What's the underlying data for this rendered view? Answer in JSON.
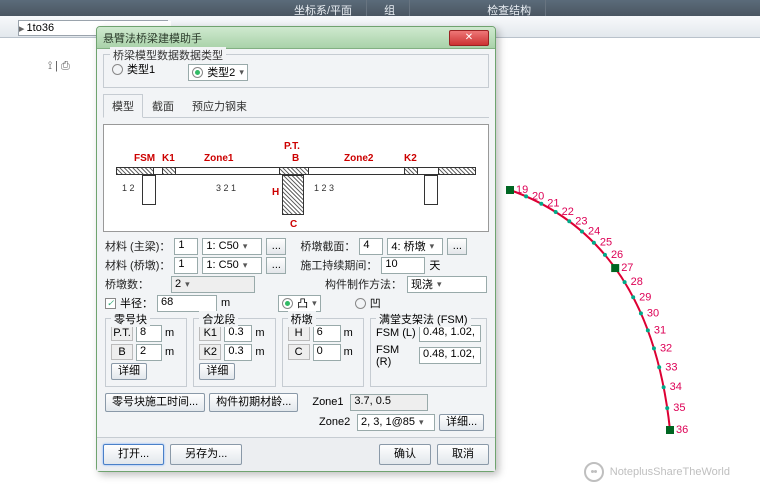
{
  "toolbar": {
    "t1": "坐标系/平面",
    "t2": "组",
    "t3": "检查结构"
  },
  "file_input": "1to36",
  "dialog": {
    "title": "悬臂法桥梁建模助手",
    "data_type_legend": "桥梁模型数据数据类型",
    "type1": "类型1",
    "type2": "类型2",
    "tabs": {
      "model": "模型",
      "section": "截面",
      "prestress": "预应力钢束"
    },
    "diagram": {
      "fsm": "FSM",
      "k1": "K1",
      "zone1": "Zone1",
      "pt": "P.T.",
      "b": "B",
      "zone2": "Zone2",
      "k2": "K2",
      "h": "H",
      "c": "C"
    },
    "mat_main_lbl": "材料 (主梁)：",
    "mat_main_n": "1",
    "mat_main_v": "1: C50",
    "mat_pier_lbl": "材料 (桥墩)：",
    "mat_pier_n": "1",
    "mat_pier_v": "1: C50",
    "pier_sec_lbl": "桥墩截面：",
    "pier_sec_n": "4",
    "pier_sec_v": "4: 桥墩",
    "dur_lbl": "施工持续期间：",
    "dur_v": "10",
    "dur_u": "天",
    "count_lbl": "桥墩数：",
    "count_v": "2",
    "fab_lbl": "构件制作方法：",
    "fab_v": "现浇",
    "radius_chk": "半径：",
    "radius_v": "68",
    "radius_u": "m",
    "convex": "凸",
    "concave": "凹",
    "g0": "零号块",
    "g1": "合龙段",
    "g2": "桥墩",
    "g3": "满堂支架法 (FSM)",
    "pt_lbl": "P.T.",
    "pt_v": "8",
    "b_lbl": "B",
    "b_v": "2",
    "k1_lbl": "K1",
    "k1_v": "0.3",
    "k2_lbl": "K2",
    "k2_v": "0.3",
    "h_lbl": "H",
    "h_v": "6",
    "c_lbl": "C",
    "c_v": "0",
    "fsml_lbl": "FSM (L)",
    "fsml_v": "0.48, 1.02,",
    "fsmr_lbl": "FSM (R)",
    "fsmr_v": "0.48, 1.02,",
    "m": "m",
    "detail": "详细",
    "detail2": "详细...",
    "zone1_lbl": "Zone1",
    "zone1_v": "3.7, 0.5",
    "zone2_lbl": "Zone2",
    "zone2_v": "2, 3, 1@85",
    "btn_time": "零号块施工时间...",
    "btn_init": "构件初期材龄...",
    "open": "打开...",
    "saveas": "另存为...",
    "ok": "确认",
    "cancel": "取消"
  },
  "curve_nums": [
    "19",
    "20",
    "21",
    "22",
    "23",
    "24",
    "25",
    "26",
    "27",
    "28",
    "29",
    "30",
    "31",
    "32",
    "33",
    "34",
    "35",
    "36"
  ],
  "watermark": "NoteplusShareTheWorld"
}
